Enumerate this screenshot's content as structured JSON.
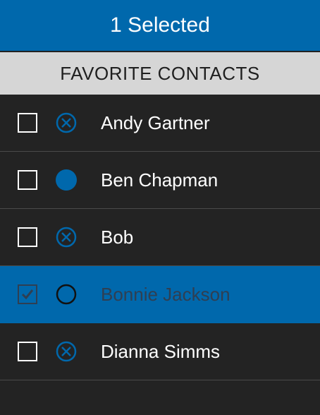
{
  "header": {
    "title": "1 Selected"
  },
  "section": {
    "title": "FAVORITE CONTACTS"
  },
  "contacts": [
    {
      "name": "Andy Gartner",
      "checked": false,
      "status": "unavailable-x-icon"
    },
    {
      "name": "Ben Chapman",
      "checked": false,
      "status": "available-filled-icon"
    },
    {
      "name": "Bob",
      "checked": false,
      "status": "unavailable-x-icon"
    },
    {
      "name": "Bonnie Jackson",
      "checked": true,
      "status": "offline-empty-icon"
    },
    {
      "name": "Dianna Simms",
      "checked": false,
      "status": "unavailable-x-icon"
    }
  ],
  "colors": {
    "accent": "#0068ac",
    "background": "#232323",
    "section_background": "#d6d6d6",
    "selected_text": "#2f3f52"
  }
}
